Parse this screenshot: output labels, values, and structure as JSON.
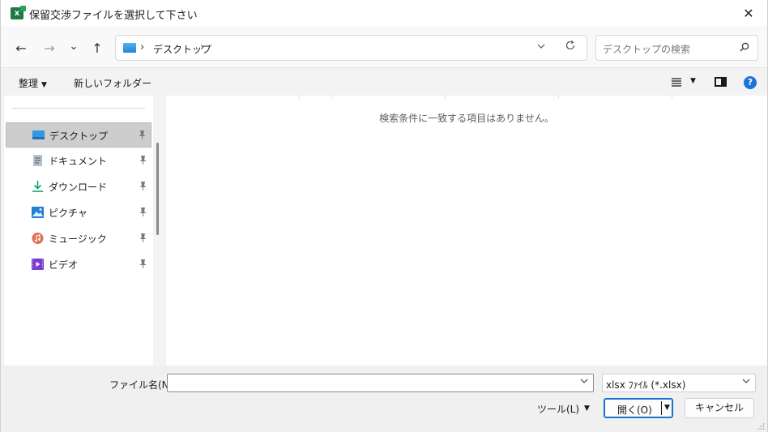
{
  "window": {
    "title": "保留交渉ファイルを選択して下さい",
    "app_icon_letter": "x",
    "close_glyph": "✕"
  },
  "nav": {
    "back_glyph": "←",
    "forward_glyph": "→",
    "recent_glyph": "⌄",
    "up_glyph": "↑",
    "breadcrumb": [
      "デスクトップ"
    ],
    "separator": "›",
    "search_placeholder": "デスクトップの検索"
  },
  "toolbar": {
    "organize_label": "整理",
    "new_folder_label": "新しいフォルダー",
    "help_glyph": "?"
  },
  "sidebar": {
    "items": [
      {
        "label": "デスクトップ",
        "icon": "desktop-icon",
        "selected": true
      },
      {
        "label": "ドキュメント",
        "icon": "document-icon",
        "selected": false
      },
      {
        "label": "ダウンロード",
        "icon": "download-icon",
        "selected": false
      },
      {
        "label": "ピクチャ",
        "icon": "picture-icon",
        "selected": false
      },
      {
        "label": "ミュージック",
        "icon": "music-icon",
        "selected": false
      },
      {
        "label": "ビデオ",
        "icon": "video-icon",
        "selected": false
      }
    ]
  },
  "content": {
    "empty_message": "検索条件に一致する項目はありません。"
  },
  "footer": {
    "filename_label": "ファイル名(N):",
    "filename_value": "",
    "filetype_value": "xlsx ﾌｧｲﾙ (*.xlsx)",
    "tools_label": "ツール(L)",
    "open_label": "開く(O)",
    "cancel_label": "キャンセル"
  },
  "colors": {
    "accent": "#1a6fd0",
    "selected_bg": "#cdcdcd",
    "excel_green": "#1d7a45"
  }
}
